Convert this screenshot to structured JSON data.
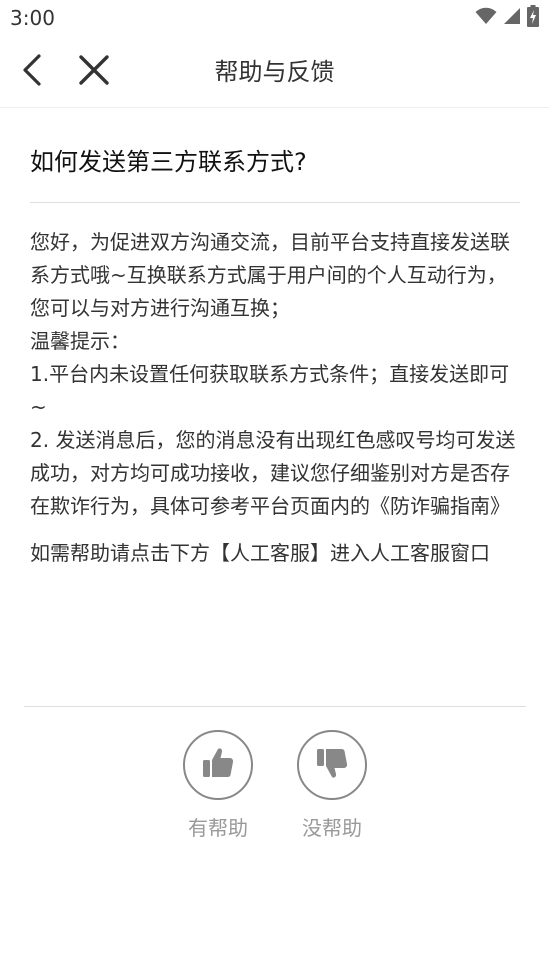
{
  "status_bar": {
    "time": "3:00",
    "icons": [
      "wifi-icon",
      "cellular-signal-icon",
      "battery-charging-icon"
    ]
  },
  "nav": {
    "title": "帮助与反馈",
    "back_icon": "chevron-left-icon",
    "close_icon": "close-icon"
  },
  "article": {
    "title": "如何发送第三方联系方式?",
    "paragraphs": [
      "您好，为促进双方沟通交流，目前平台支持直接发送联系方式哦~互换联系方式属于用户间的个人互动行为，您可以与对方进行沟通互换；",
      "温馨提示：",
      "1.平台内未设置任何获取联系方式条件；直接发送即可~",
      "2. 发送消息后，您的消息没有出现红色感叹号均可发送成功，对方均可成功接收，建议您仔细鉴别对方是否存在欺诈行为，具体可参考平台页面内的《防诈骗指南》",
      "如需帮助请点击下方【人工客服】进入人工客服窗口"
    ]
  },
  "feedback": {
    "helpful_label": "有帮助",
    "not_helpful_label": "没帮助",
    "helpful_icon": "thumbs-up-icon",
    "not_helpful_icon": "thumbs-down-icon"
  },
  "colors": {
    "icon_gray": "#888888",
    "label_gray": "#999999",
    "text": "#333333"
  }
}
